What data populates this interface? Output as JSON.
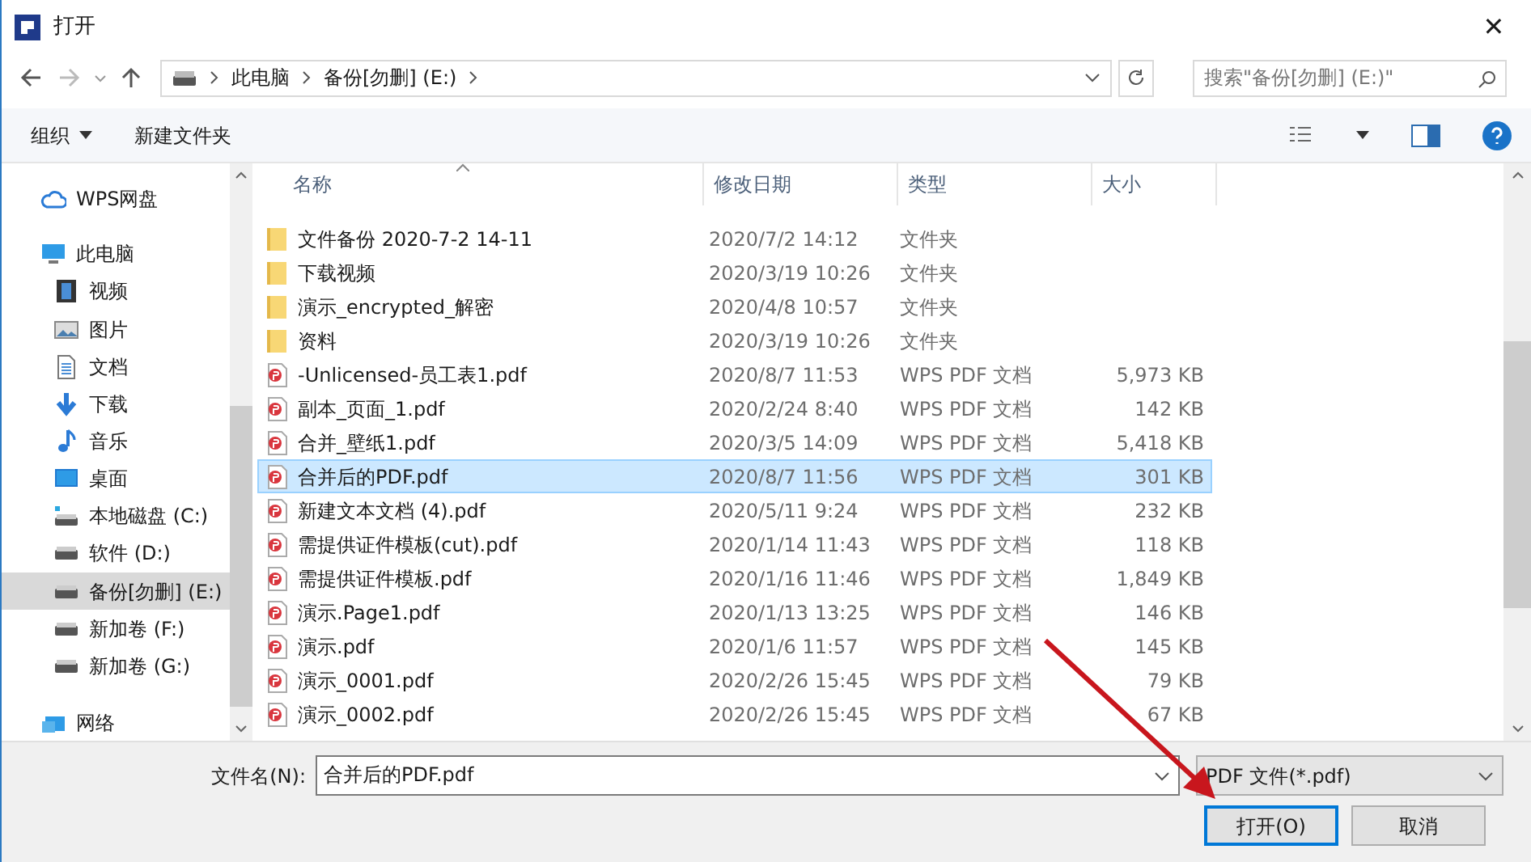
{
  "window": {
    "title": "打开",
    "close": "✕"
  },
  "address": {
    "crumbs": [
      "此电脑",
      "备份[勿删] (E:)"
    ],
    "search_placeholder": "搜索\"备份[勿删] (E:)\""
  },
  "toolbar": {
    "organize": "组织",
    "new_folder": "新建文件夹"
  },
  "sidebar": {
    "items": [
      {
        "label": "WPS网盘",
        "kind": "cloud",
        "selected": false
      },
      {
        "label": "此电脑",
        "kind": "pc",
        "selected": false,
        "children": [
          {
            "label": "视频",
            "kind": "video",
            "selected": false
          },
          {
            "label": "图片",
            "kind": "image",
            "selected": false
          },
          {
            "label": "文档",
            "kind": "doc",
            "selected": false
          },
          {
            "label": "下载",
            "kind": "download",
            "selected": false
          },
          {
            "label": "音乐",
            "kind": "music",
            "selected": false
          },
          {
            "label": "桌面",
            "kind": "desktop",
            "selected": false
          },
          {
            "label": "本地磁盘 (C:)",
            "kind": "sysdrive",
            "selected": false
          },
          {
            "label": "软件 (D:)",
            "kind": "drive",
            "selected": false
          },
          {
            "label": "备份[勿删] (E:)",
            "kind": "drive",
            "selected": true
          },
          {
            "label": "新加卷 (F:)",
            "kind": "drive",
            "selected": false
          },
          {
            "label": "新加卷 (G:)",
            "kind": "drive",
            "selected": false
          }
        ]
      },
      {
        "label": "网络",
        "kind": "network",
        "selected": false
      }
    ]
  },
  "table": {
    "columns": [
      "名称",
      "修改日期",
      "类型",
      "大小"
    ],
    "rows": [
      {
        "name": "文件备份 2020-7-2 14-11",
        "date": "2020/7/2 14:12",
        "type": "文件夹",
        "kind": "folder",
        "selected": false
      },
      {
        "name": "下载视频",
        "date": "2020/3/19 10:26",
        "type": "文件夹",
        "kind": "folder",
        "selected": false
      },
      {
        "name": "演示_encrypted_解密",
        "date": "2020/4/8 10:57",
        "type": "文件夹",
        "kind": "folder",
        "selected": false
      },
      {
        "name": "资料",
        "date": "2020/3/19 10:26",
        "type": "文件夹",
        "kind": "folder",
        "selected": false
      },
      {
        "name": "-Unlicensed-员工表1.pdf",
        "date": "2020/8/7 11:53",
        "type": "WPS PDF 文档",
        "size": "5,973 KB",
        "kind": "pdf",
        "selected": false
      },
      {
        "name": "副本_页面_1.pdf",
        "date": "2020/2/24 8:40",
        "type": "WPS PDF 文档",
        "size": "142 KB",
        "kind": "pdf",
        "selected": false
      },
      {
        "name": "合并_壁纸1.pdf",
        "date": "2020/3/5 14:09",
        "type": "WPS PDF 文档",
        "size": "5,418 KB",
        "kind": "pdf",
        "selected": false
      },
      {
        "name": "合并后的PDF.pdf",
        "date": "2020/8/7 11:56",
        "type": "WPS PDF 文档",
        "size": "301 KB",
        "kind": "pdf",
        "selected": true
      },
      {
        "name": "新建文本文档 (4).pdf",
        "date": "2020/5/11 9:24",
        "type": "WPS PDF 文档",
        "size": "232 KB",
        "kind": "pdf",
        "selected": false
      },
      {
        "name": "需提供证件模板(cut).pdf",
        "date": "2020/1/14 11:43",
        "type": "WPS PDF 文档",
        "size": "118 KB",
        "kind": "pdf",
        "selected": false
      },
      {
        "name": "需提供证件模板.pdf",
        "date": "2020/1/16 11:46",
        "type": "WPS PDF 文档",
        "size": "1,849 KB",
        "kind": "pdf",
        "selected": false
      },
      {
        "name": "演示.Page1.pdf",
        "date": "2020/1/13 13:25",
        "type": "WPS PDF 文档",
        "size": "146 KB",
        "kind": "pdf",
        "selected": false
      },
      {
        "name": "演示.pdf",
        "date": "2020/1/6 11:57",
        "type": "WPS PDF 文档",
        "size": "145 KB",
        "kind": "pdf",
        "selected": false
      },
      {
        "name": "演示_0001.pdf",
        "date": "2020/2/26 15:45",
        "type": "WPS PDF 文档",
        "size": "79 KB",
        "kind": "pdf",
        "selected": false
      },
      {
        "name": "演示_0002.pdf",
        "date": "2020/2/26 15:45",
        "type": "WPS PDF 文档",
        "size": "67 KB",
        "kind": "pdf",
        "selected": false
      }
    ]
  },
  "footer": {
    "filename_label": "文件名(N):",
    "filename": "合并后的PDF.pdf",
    "filetype": "PDF 文件(*.pdf)",
    "buttons": [
      {
        "label": "打开(O)",
        "kind": "default"
      },
      {
        "label": "取消",
        "kind": "normal"
      }
    ]
  }
}
